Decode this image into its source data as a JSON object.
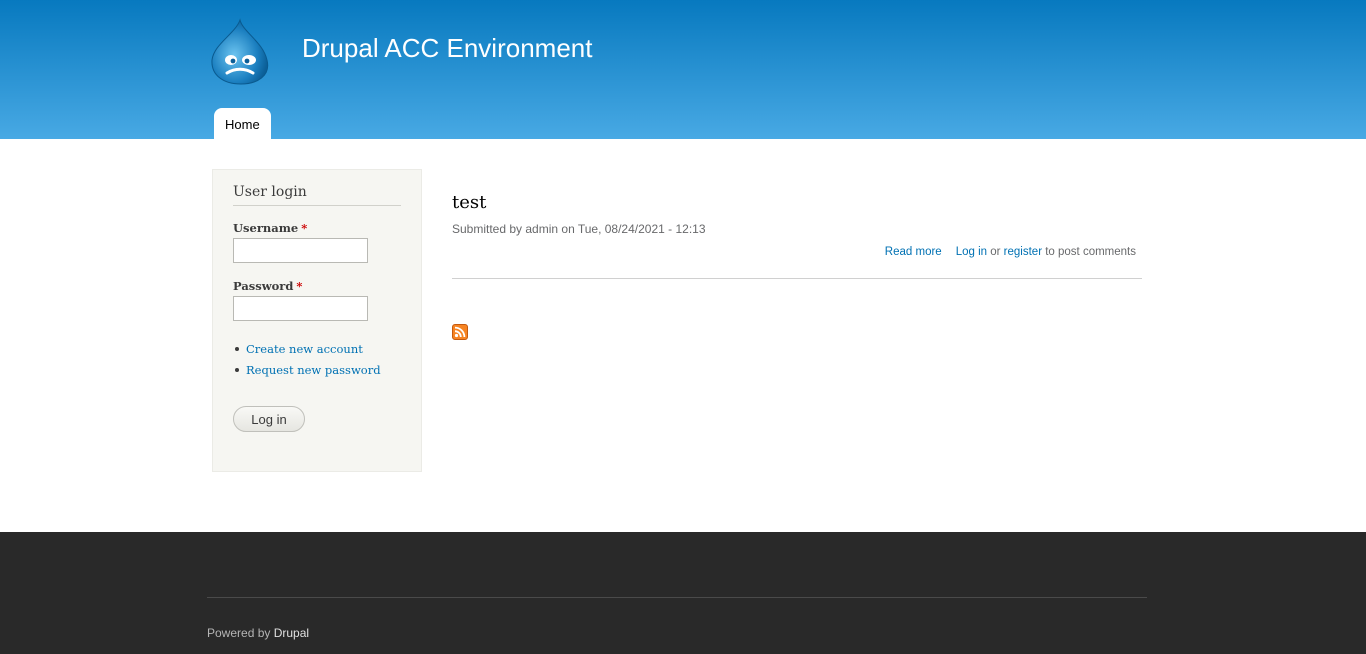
{
  "header": {
    "site_name": "Drupal ACC Environment",
    "logo_icon": "drupal-drop-logo",
    "colors": {
      "gradient_top": "#0779bf",
      "gradient_bottom": "#48a9e4"
    }
  },
  "main_menu": {
    "items": [
      {
        "label": "Home"
      }
    ]
  },
  "sidebar": {
    "block_title": "User login",
    "username_label": "Username",
    "password_label": "Password",
    "required_marker": "*",
    "username_value": "",
    "password_value": "",
    "links": [
      {
        "label": "Create new account"
      },
      {
        "label": "Request new password"
      }
    ],
    "submit_label": "Log in"
  },
  "node": {
    "title": "test",
    "submitted": "Submitted by admin on Tue, 08/24/2021 - 12:13",
    "read_more": "Read more",
    "login_link": "Log in",
    "or_text": "or",
    "register_link": "register",
    "post_comments_text": "to post comments"
  },
  "feed": {
    "icon": "rss-feed-icon"
  },
  "footer": {
    "powered_prefix": "Powered by",
    "powered_link": "Drupal"
  },
  "colors": {
    "link": "#0071b3",
    "footer_bg": "#292929",
    "sidebar_bg": "#f6f6f2",
    "required": "#cc0000"
  }
}
